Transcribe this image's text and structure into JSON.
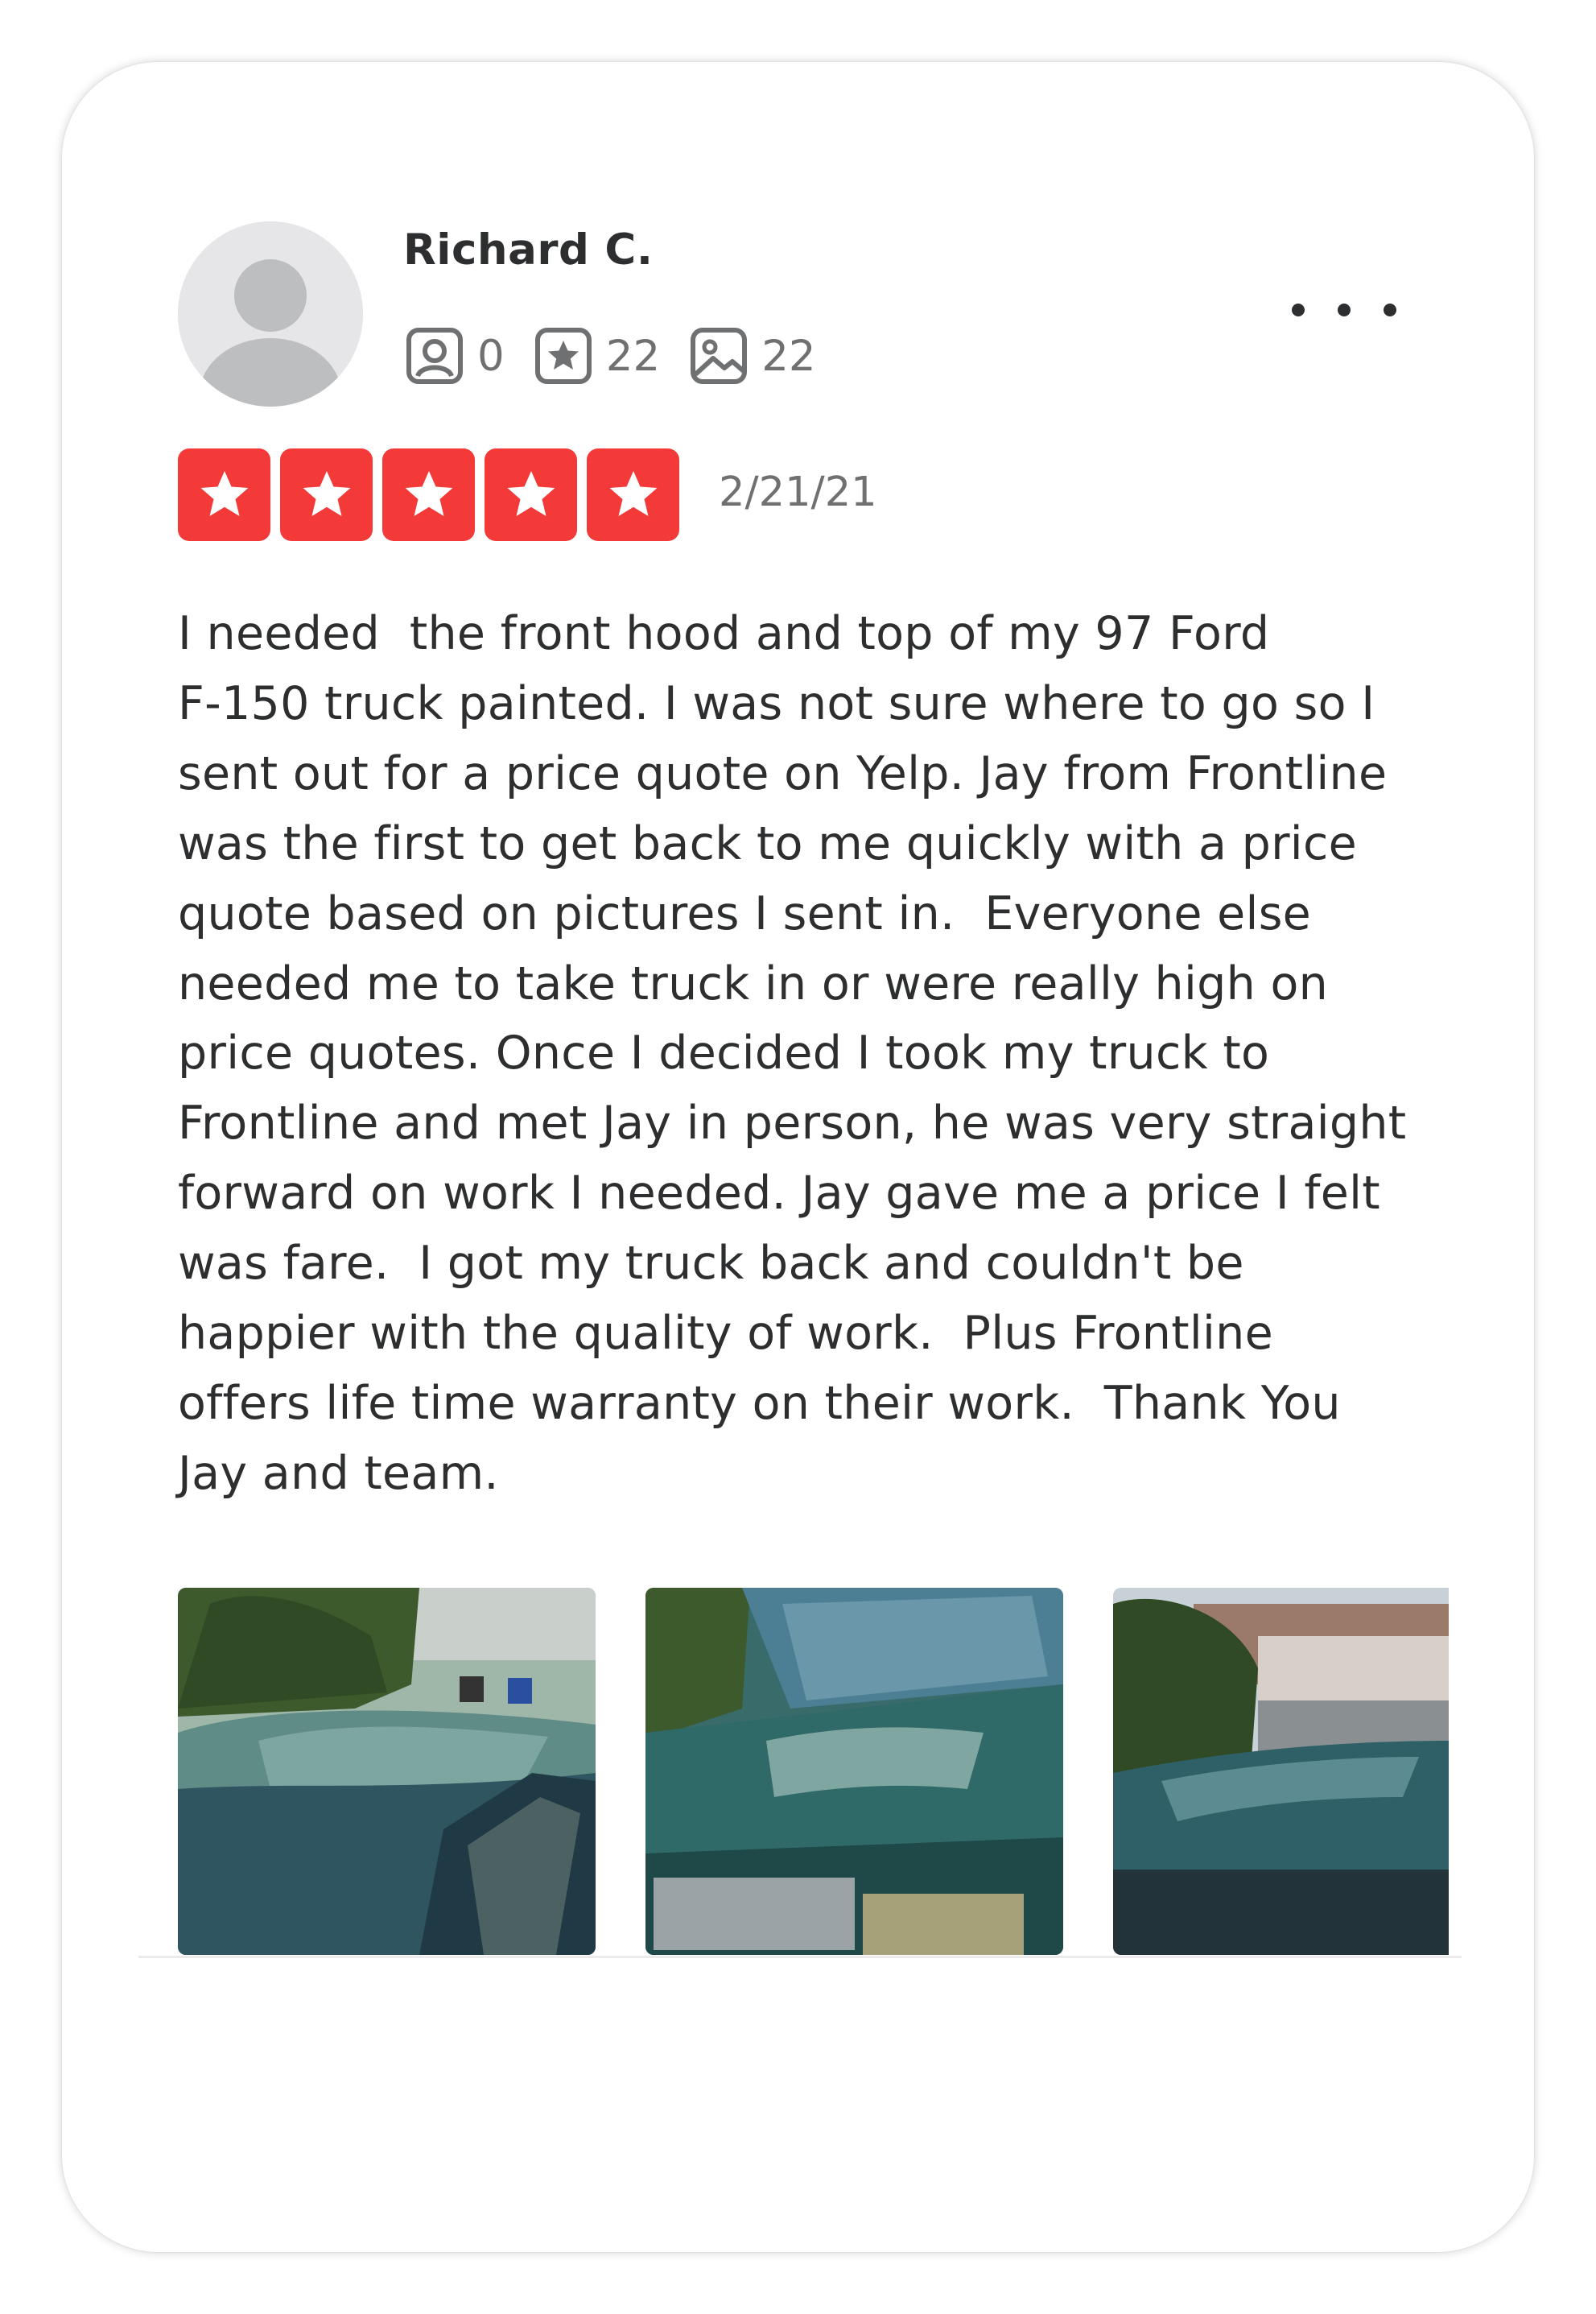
{
  "review": {
    "user": {
      "name": "Richard C.",
      "avatar_icon": "default-avatar-icon",
      "stats": [
        {
          "icon": "friends-icon",
          "value": "0"
        },
        {
          "icon": "reviews-star-icon",
          "value": "22"
        },
        {
          "icon": "photos-icon",
          "value": "22"
        }
      ]
    },
    "more_icon": "more-dots-icon",
    "rating": 5,
    "rating_color": "#f43939",
    "date": "2/21/21",
    "text_lines": [
      "I needed  the front hood and top of my 97 Ford",
      "F-150 truck painted. I was not sure where to go so I",
      "sent out for a price quote on Yelp. Jay from Frontline",
      "was the first to get back to me quickly with a price",
      "quote based on pictures I sent in.  Everyone else",
      "needed me to take truck in or were really high on",
      "price quotes. Once I decided I took my truck to",
      "Frontline and met Jay in person, he was very straight",
      "forward on work I needed. Jay gave me a price I felt",
      "was fare.  I got my truck back and couldn't be",
      "happier with the quality of work.  Plus Frontline",
      "offers life time warranty on their work.  Thank You",
      "Jay and team."
    ],
    "photos": [
      {
        "name": "review-photo-truck-roof"
      },
      {
        "name": "review-photo-truck-hood"
      },
      {
        "name": "review-photo-truck-roof-side"
      }
    ]
  }
}
